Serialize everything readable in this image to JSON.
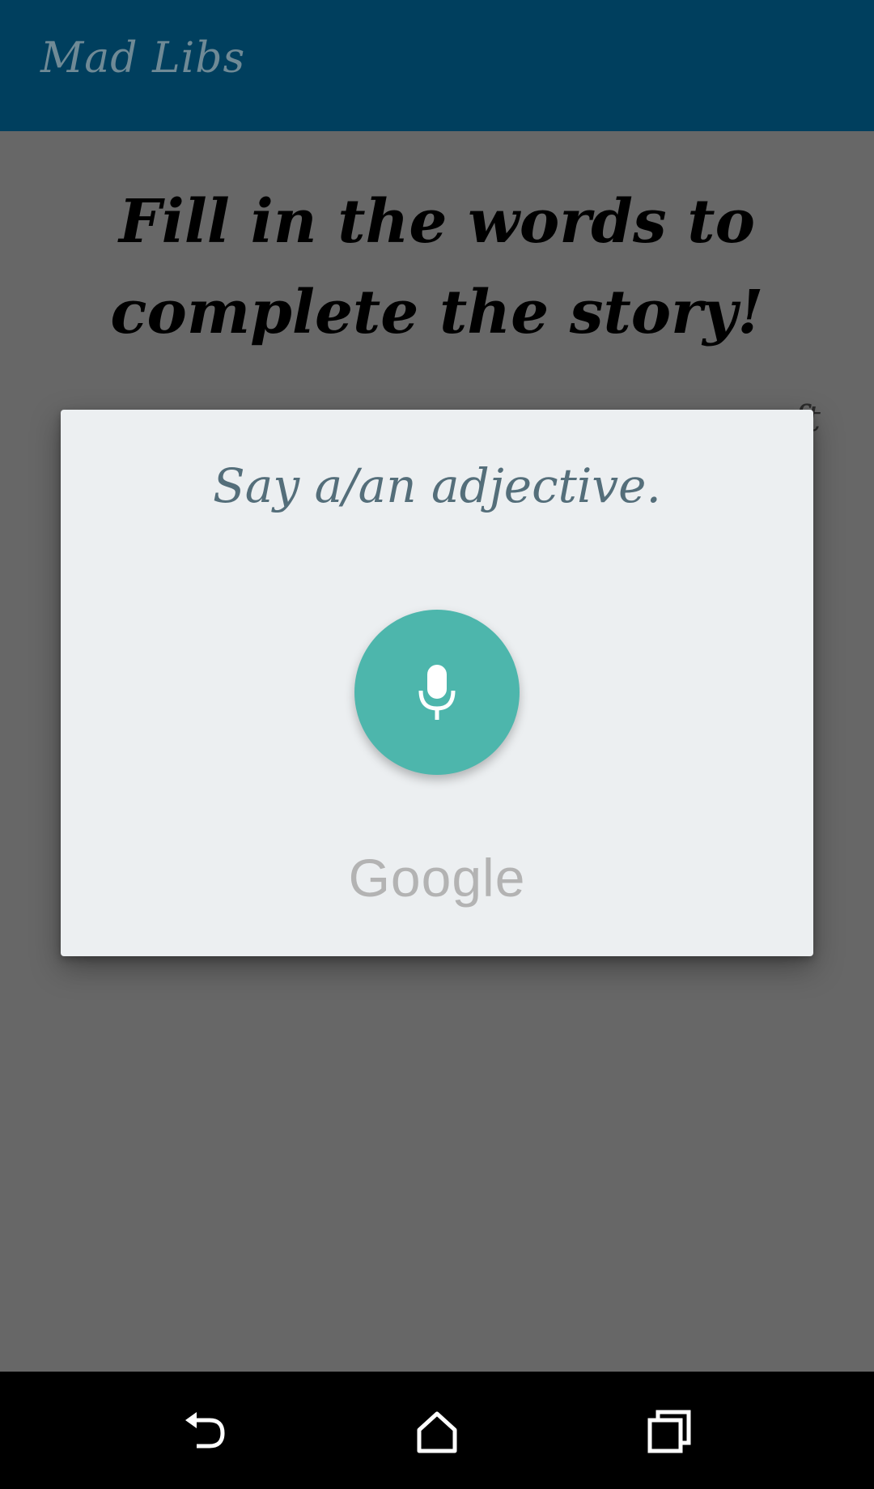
{
  "app_bar": {
    "title": "Mad Libs"
  },
  "main": {
    "headline": "Fill in the words to complete the story!",
    "peek_text": "ft"
  },
  "dialog": {
    "prompt": "Say a/an adjective.",
    "mic_icon": "microphone-icon",
    "brand": "Google"
  },
  "nav_bar": {
    "back_icon": "back-icon",
    "home_icon": "home-icon",
    "recents_icon": "recents-icon"
  },
  "colors": {
    "app_bar": "#003f5e",
    "scrim": "#666666",
    "dialog_bg": "#eceff1",
    "mic_button": "#4db6ac",
    "prompt_text": "#546e7a"
  }
}
